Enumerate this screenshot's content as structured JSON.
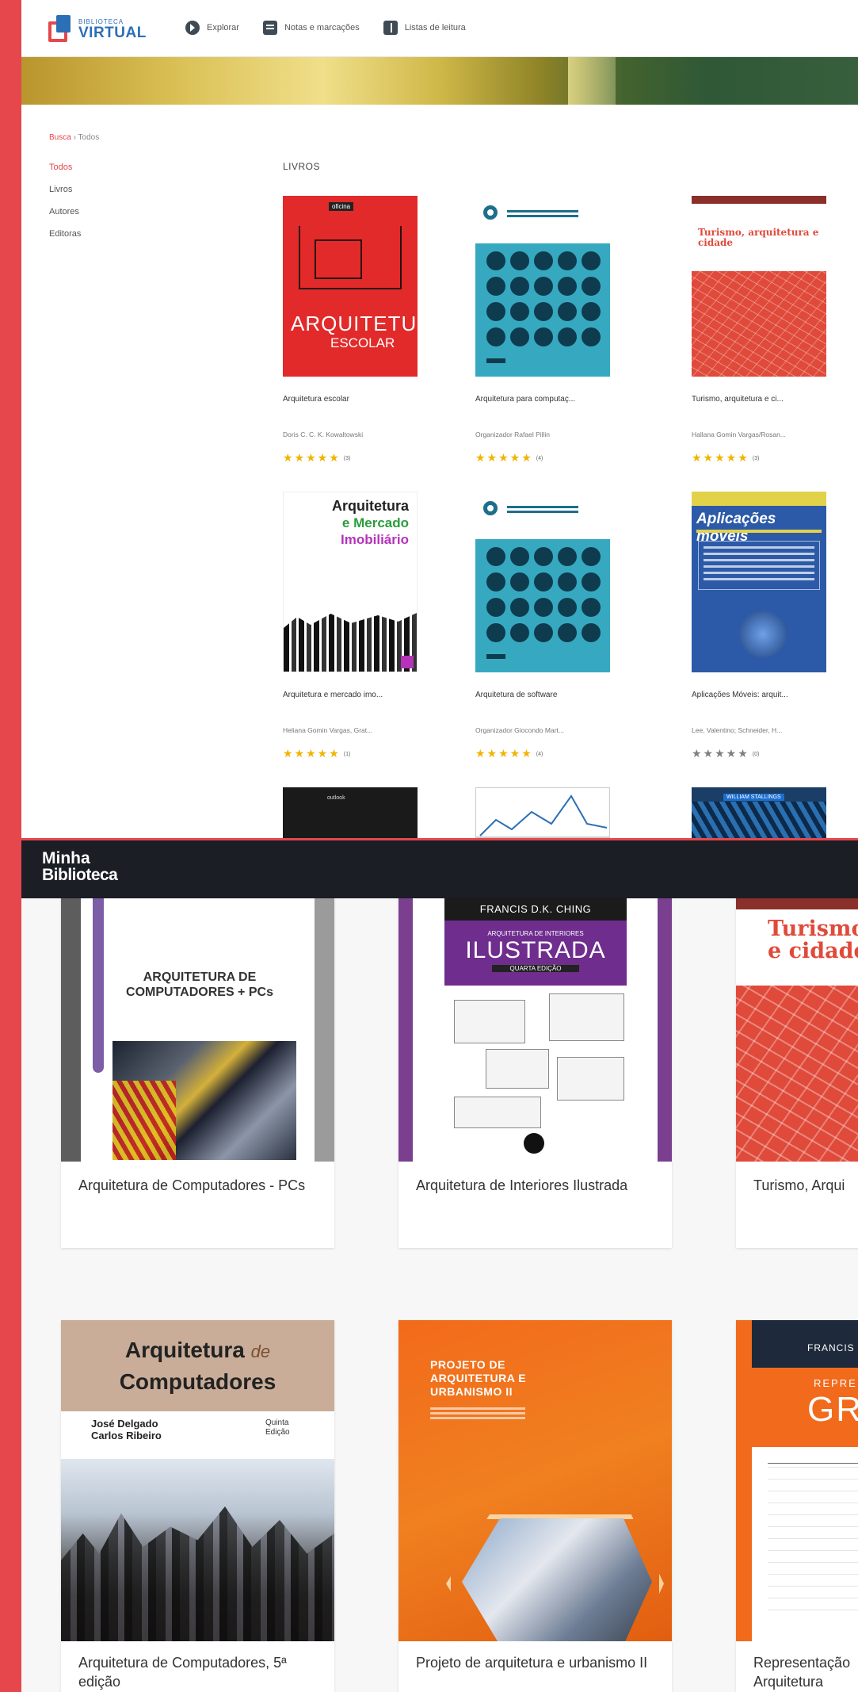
{
  "bv": {
    "logo": {
      "small": "BIBLIOTECA",
      "big": "VIRTUAL"
    },
    "nav": [
      {
        "label": "Explorar",
        "icon": "explore-icon"
      },
      {
        "label": "Notas e marcações",
        "icon": "notes-icon"
      },
      {
        "label": "Listas de leitura",
        "icon": "reading-list-icon"
      }
    ],
    "breadcrumb": {
      "link": "Busca",
      "separator": "›",
      "current": "Todos"
    },
    "sidebar": [
      "Todos",
      "Livros",
      "Autores",
      "Editoras"
    ],
    "section_title": "LIVROS",
    "books": [
      {
        "title": "Arquitetura escolar",
        "author": "Doris C. C. K. Kowaltowski",
        "stars": "★★★★★",
        "count": "(3)",
        "cover": {
          "pub": "oficina",
          "t1": "ARQUITETURA",
          "t2": "ESCOLAR"
        }
      },
      {
        "title": "Arquitetura para computaç...",
        "author": "Organizador Rafael Pillin",
        "stars": "★★★★★",
        "count": "(4)"
      },
      {
        "title": "Turismo, arquitetura e ci...",
        "author": "Hallana Gomin Vargas/Rosan...",
        "stars": "★★★★★",
        "count": "(3)",
        "cover": {
          "title": "Turismo, arquitetura e cidade"
        }
      },
      {
        "title": "Arquitetura e mercado imo...",
        "author": "Heliana Gomin Vargas, Grat...",
        "stars": "★★★★★",
        "count": "(1)",
        "cover": {
          "t1": "Arquitetura",
          "t2": "e Mercado",
          "t3": "Imobiliário"
        }
      },
      {
        "title": "Arquitetura de software",
        "author": "Organizador Giocondo Mart...",
        "stars": "★★★★★",
        "count": "(4)"
      },
      {
        "title": "Aplicações Móveis: arquit...",
        "author": "Lee, Valentino; Schneider, H...",
        "stars": "★★★★★",
        "count": "(0)",
        "cover": {
          "title": "Aplicações móveis"
        }
      }
    ],
    "more_covers": [
      {
        "tag": "outlook"
      },
      {},
      {
        "tag": "WILLIAM STALLINGS"
      }
    ]
  },
  "mb": {
    "logo": {
      "line1": "Minha",
      "line2": "Biblioteca"
    },
    "books": [
      {
        "title": "Arquitetura de Computadores - PCs",
        "cover": {
          "label": "ARQUITETURA DE COMPUTADORES + PCs"
        }
      },
      {
        "title": "Arquitetura de Interiores Ilustrada",
        "cover": {
          "author": "FRANCIS D.K. CHING",
          "big": "ILUSTRADA",
          "small": "ARQUITETURA DE INTERIORES",
          "edition": "QUARTA EDIÇÃO"
        }
      },
      {
        "title": "Turismo, Arqui",
        "cover": {
          "title": "Turismo,\ne cidade"
        }
      },
      {
        "title": "Arquitetura de Computadores, 5ª edição",
        "cover": {
          "t1": "Arquitetura",
          "t1b": "de",
          "t2": "Computadores",
          "authors": "José Delgado\nCarlos Ribeiro",
          "edition": "Quinta\nEdição"
        }
      },
      {
        "title": "Projeto de arquitetura e urbanismo II",
        "cover": {
          "title": "PROJETO DE\nARQUITETURA E\nURBANISMO II"
        }
      },
      {
        "title": "Representação\nArquitetura",
        "cover": {
          "author": "FRANCIS",
          "r": "REPRE",
          "g": "GRA"
        }
      }
    ]
  },
  "colors": {
    "accent": "#e5474c",
    "brand_blue": "#2b6fb6",
    "mb_header": "#1b1e25",
    "star": "#f0b400"
  }
}
